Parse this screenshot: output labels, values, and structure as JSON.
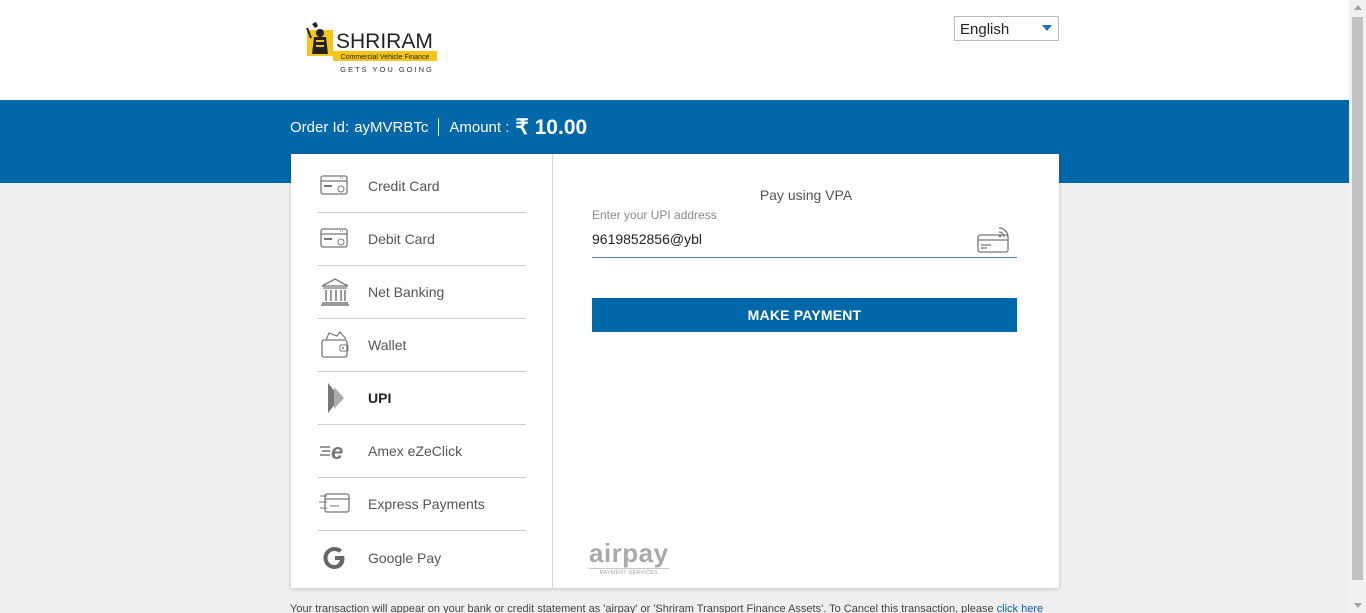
{
  "header": {
    "logo": {
      "brand": "SHRIRAM",
      "subtitle": "Commercial Vehicle Finance",
      "tagline": "GETS YOU GOING",
      "colors": {
        "yellow": "#f5c518",
        "dark": "#222222"
      }
    },
    "language": {
      "selected": "English"
    }
  },
  "order": {
    "id_label": "Order Id:",
    "id_value": "ayMVRBTc",
    "amount_label": "Amount :",
    "currency_symbol": "₹",
    "amount_value": "10.00"
  },
  "payment_methods": [
    {
      "label": "Credit Card",
      "icon": "credit-card-icon",
      "active": false
    },
    {
      "label": "Debit Card",
      "icon": "debit-card-icon",
      "active": false
    },
    {
      "label": "Net Banking",
      "icon": "bank-icon",
      "active": false
    },
    {
      "label": "Wallet",
      "icon": "wallet-icon",
      "active": false
    },
    {
      "label": "UPI",
      "icon": "upi-icon",
      "active": true
    },
    {
      "label": "Amex eZeClick",
      "icon": "amex-ezeclick-icon",
      "active": false
    },
    {
      "label": "Express Payments",
      "icon": "express-card-icon",
      "active": false
    },
    {
      "label": "Google Pay",
      "icon": "google-icon",
      "active": false
    }
  ],
  "upi_pane": {
    "title": "Pay using VPA",
    "field_label": "Enter your UPI address",
    "field_value": "9619852856@ybl",
    "button_label": "MAKE PAYMENT"
  },
  "airpay": {
    "brand": "airpay",
    "tagline": "PAYMENT SERVICES"
  },
  "footer": {
    "text": "Your transaction will appear on your bank or credit statement as 'airpay' or 'Shriram Transport Finance Assets'. To Cancel this transaction, please",
    "link": "click here"
  },
  "colors": {
    "primary": "#0067a9",
    "background": "#efefef"
  }
}
